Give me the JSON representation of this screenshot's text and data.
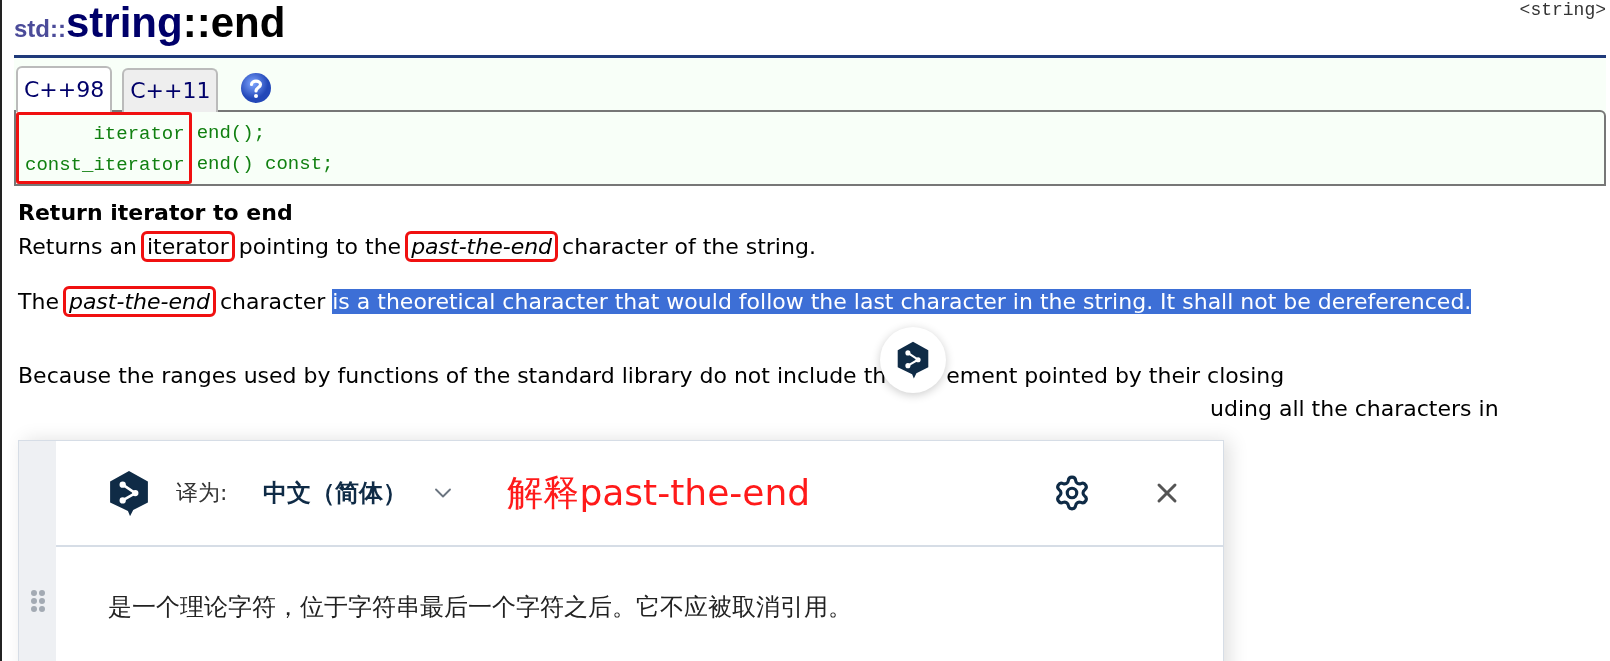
{
  "title": {
    "namespace": "std::",
    "name": "string",
    "member": "::end"
  },
  "header_tag": "<string>",
  "tabs": [
    {
      "label": "C++98",
      "selected": true
    },
    {
      "label": "C++11",
      "selected": false
    }
  ],
  "code": {
    "types_boxed": true,
    "lines": [
      {
        "type": "iterator",
        "signature": "end();"
      },
      {
        "type": "const_iterator",
        "signature": "end() const;"
      }
    ]
  },
  "heading": "Return iterator to end",
  "paragraphs": [
    [
      {
        "text": "Returns an ",
        "italic": false,
        "boxed": false,
        "selected": false
      },
      {
        "text": "iterator",
        "italic": false,
        "boxed": true,
        "selected": false
      },
      {
        "text": " pointing to the ",
        "italic": false,
        "boxed": false,
        "selected": false
      },
      {
        "text": "past-the-end",
        "italic": true,
        "boxed": true,
        "selected": false
      },
      {
        "text": " character of the string.",
        "italic": false,
        "boxed": false,
        "selected": false
      }
    ],
    [
      {
        "text": "The ",
        "italic": false,
        "boxed": false,
        "selected": false
      },
      {
        "text": "past-the-end",
        "italic": true,
        "boxed": true,
        "selected": false
      },
      {
        "text": " character ",
        "italic": false,
        "boxed": false,
        "selected": false
      },
      {
        "text": "is a theoretical character that would follow the last character in the string. It shall not be dereferenced.",
        "italic": false,
        "boxed": false,
        "selected": true
      }
    ]
  ],
  "partial_paragraph": {
    "line_1_start": "Because the ranges used by functions of the standard library do not include th",
    "line_1_end": "ement pointed by their closing",
    "line_2_end": "uding all the characters in"
  },
  "translator": {
    "target_label": "译为:",
    "language": "中文（简体）",
    "note": "解释past-the-end",
    "translation": "是一个理论字符，位于字符串最后一个字符之后。它不应被取消引用。"
  }
}
